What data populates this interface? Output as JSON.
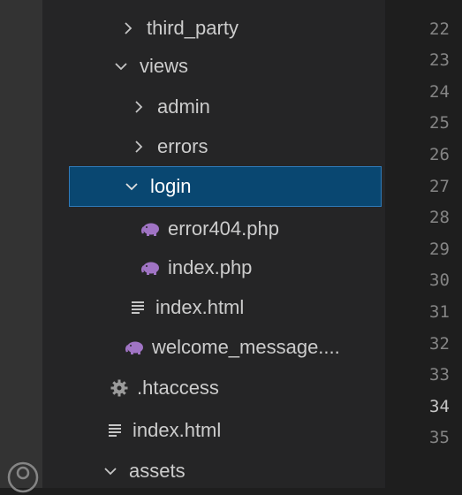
{
  "explorer": {
    "items": [
      {
        "label": "third_party",
        "type": "folder",
        "expanded": false
      },
      {
        "label": "views",
        "type": "folder",
        "expanded": true
      },
      {
        "label": "admin",
        "type": "folder",
        "expanded": false
      },
      {
        "label": "errors",
        "type": "folder",
        "expanded": false
      },
      {
        "label": "login",
        "type": "folder",
        "expanded": true,
        "selected": true
      },
      {
        "label": "error404.php",
        "type": "php-file",
        "icon": "php-elephant-icon"
      },
      {
        "label": "index.php",
        "type": "php-file",
        "icon": "php-elephant-icon"
      },
      {
        "label": "index.html",
        "type": "html-file",
        "icon": "lines-file-icon"
      },
      {
        "label": "welcome_message....",
        "type": "php-file",
        "icon": "php-elephant-icon"
      },
      {
        "label": ".htaccess",
        "type": "config-file",
        "icon": "gear-icon"
      },
      {
        "label": "index.html",
        "type": "html-file",
        "icon": "lines-file-icon"
      },
      {
        "label": "assets",
        "type": "folder",
        "expanded": true
      }
    ]
  },
  "gutter": {
    "line_numbers": [
      "22",
      "23",
      "24",
      "25",
      "26",
      "27",
      "28",
      "29",
      "30",
      "31",
      "32",
      "33",
      "34",
      "35"
    ],
    "active_line": "34"
  },
  "colors": {
    "sidebar_bg": "#252526",
    "editor_bg": "#1e1e1e",
    "selection_bg": "#094771",
    "selection_border": "#2f7ab8",
    "php_icon": "#a074c4",
    "text": "#cccccc",
    "line_number": "#858585"
  }
}
